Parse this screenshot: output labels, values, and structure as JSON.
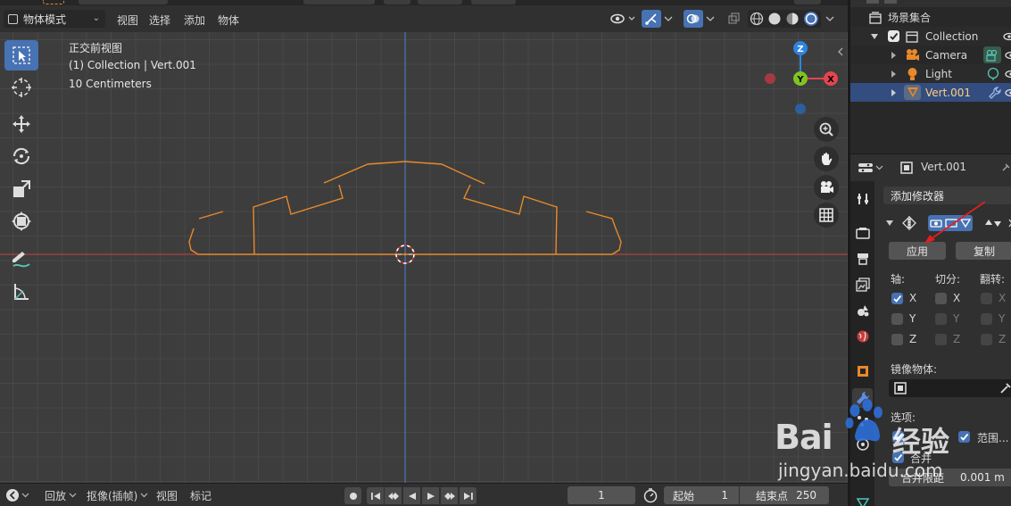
{
  "header": {
    "mode": "物体模式",
    "menus": [
      "视图",
      "选择",
      "添加",
      "物体"
    ]
  },
  "viewport": {
    "view_name": "正交前视图",
    "collection_info": "(1) Collection | Vert.001",
    "scale_info": "10 Centimeters",
    "gizmo": {
      "z": "Z",
      "y": "Y",
      "x": "X"
    }
  },
  "timeline": {
    "playback": "回放",
    "keying": "抠像(插帧)",
    "view": "视图",
    "markers": "标记",
    "current_frame": "1",
    "start_label": "起始",
    "start_value": "1",
    "end_label": "结束点",
    "end_value": "250"
  },
  "outliner": {
    "scene_collection": "场景集合",
    "items": [
      {
        "name": "Collection"
      },
      {
        "name": "Camera"
      },
      {
        "name": "Light"
      },
      {
        "name": "Vert.001"
      }
    ]
  },
  "properties": {
    "object_name": "Vert.001",
    "add_modifier": "添加修改器",
    "apply": "应用",
    "copy": "复制",
    "axis_label": "轴:",
    "bisect_label": "切分:",
    "flip_label": "翻转:",
    "axes": [
      "X",
      "Y",
      "Z"
    ],
    "mirror_object_label": "镜像物体:",
    "options_label": "选项:",
    "option_clipping": "范围...",
    "option_merge": "合并",
    "merge_limit_label": "合并限距",
    "merge_limit_value": "0.001 m"
  },
  "watermark": {
    "brand_left": "Bai",
    "brand_right": "经验",
    "url": "jingyan.baidu.com"
  },
  "colors": {
    "accent": "#4772b3",
    "mesh": "#e8892b",
    "x_axis": "#e6444f",
    "y_axis": "#80c422",
    "z_axis": "#2e84e0",
    "selected_text": "#ffcf80"
  }
}
